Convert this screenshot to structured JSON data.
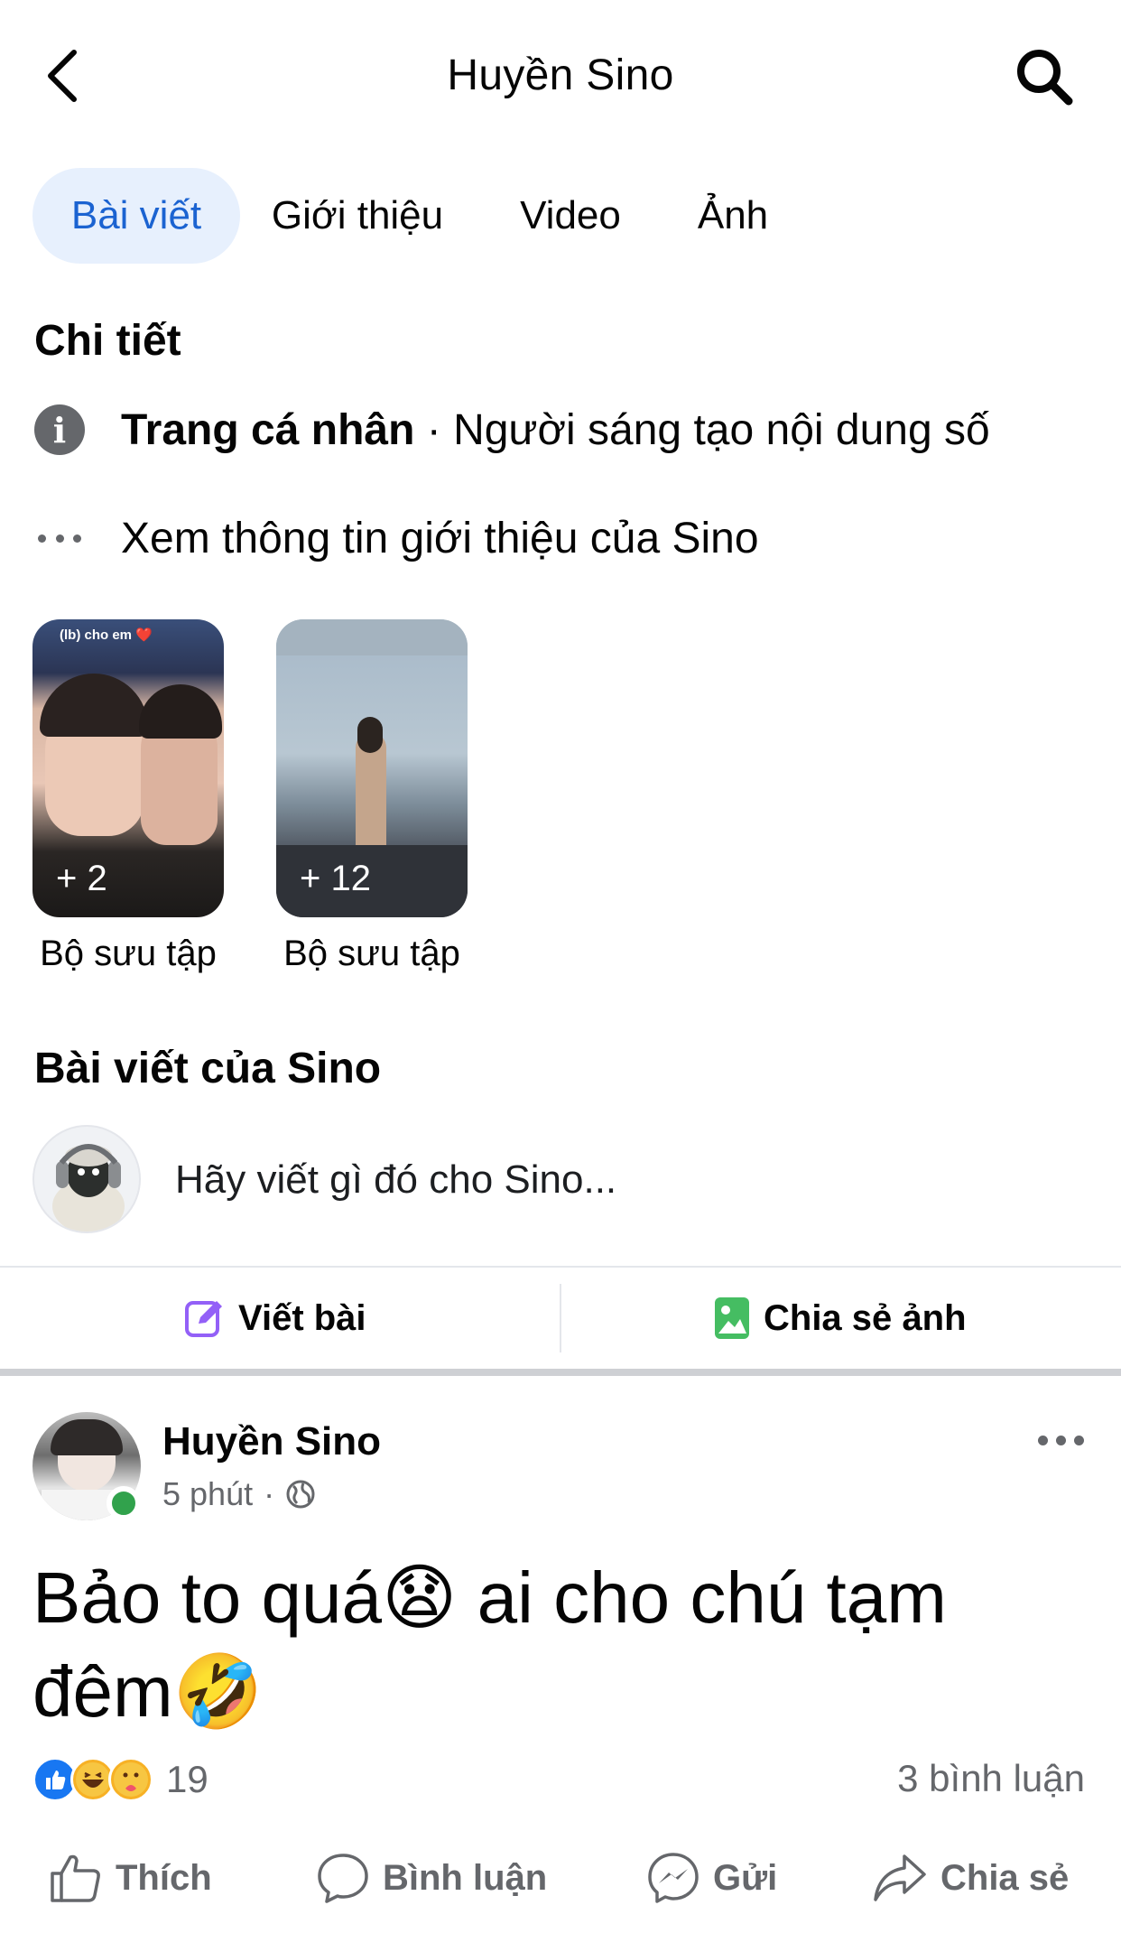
{
  "header": {
    "title": "Huyền Sino",
    "back_icon": "chevron-left-icon",
    "search_icon": "search-icon"
  },
  "tabs": [
    {
      "label": "Bài viết",
      "active": true
    },
    {
      "label": "Giới thiệu",
      "active": false
    },
    {
      "label": "Video",
      "active": false
    },
    {
      "label": "Ảnh",
      "active": false
    }
  ],
  "details": {
    "title": "Chi tiết",
    "profile_type_strong": "Trang cá nhân",
    "profile_type_rest": " · Người sáng tạo nội dung số",
    "about_link": "Xem thông tin giới thiệu của Sino"
  },
  "collections": [
    {
      "count": "+ 2",
      "label": "Bộ sưu tập",
      "caption": "(lb) cho em ❤️"
    },
    {
      "count": "+ 12",
      "label": "Bộ sưu tập"
    }
  ],
  "posts_section": {
    "title": "Bài viết của Sino",
    "composer_placeholder": "Hãy viết gì đó cho Sino...",
    "write_post_label": "Viết bài",
    "share_photo_label": "Chia sẻ ảnh"
  },
  "post": {
    "author": "Huyền Sino",
    "time": "5 phút",
    "separator": "·",
    "text": "Bảo to quá😧 ai cho chú tạm đêm🤣",
    "reaction_count": "19",
    "comment_count": "3 bình luận",
    "actions": {
      "like": "Thích",
      "comment": "Bình luận",
      "send": "Gửi",
      "share": "Chia sẻ"
    }
  },
  "colors": {
    "accent": "#1b63d1",
    "tab_active_bg": "#e7f0fd",
    "secondary_text": "#65676b",
    "online": "#31a24c",
    "write_icon": "#9360f7",
    "photo_icon": "#45bd62"
  }
}
